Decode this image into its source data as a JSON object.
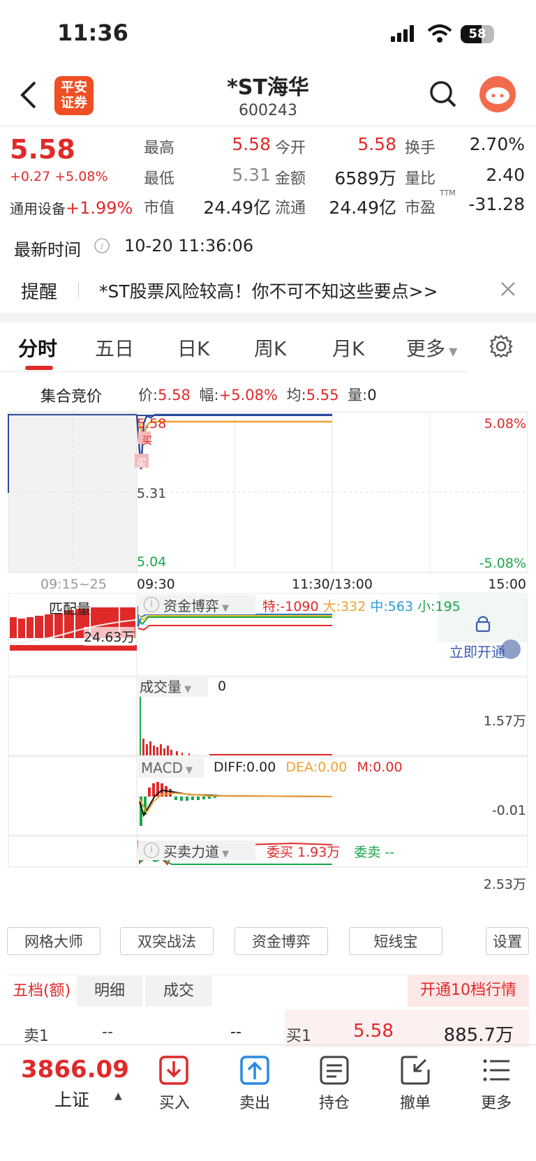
{
  "status": {
    "time": "11:36",
    "battery": "58"
  },
  "header": {
    "logo_line1": "平安",
    "logo_line2": "证券",
    "title": "*ST海华",
    "code": "600243"
  },
  "quote": {
    "price": "5.58",
    "change": "+0.27 +5.08%",
    "industry_label": "通用设备",
    "industry_change": "+1.99%",
    "rows": [
      {
        "l1": "最高",
        "v1": "5.58",
        "l2": "今开",
        "v2": "5.58",
        "l3": "换手",
        "v3": "2.70%"
      },
      {
        "l1": "最低",
        "v1": "5.31",
        "l2": "金额",
        "v2": "6589万",
        "l3": "量比",
        "v3": "2.40"
      },
      {
        "l1": "市值",
        "v1": "24.49亿",
        "l2": "流通",
        "v2": "24.49亿",
        "l3": "市盈",
        "v3": "-31.28"
      }
    ],
    "pe_sup": "TTM",
    "latest_label": "最新时间",
    "latest_time": "10-20 11:36:06"
  },
  "alert": {
    "label": "提醒",
    "text": "*ST股票风险较高！你不可不知这些要点>>"
  },
  "tabs": [
    "分时",
    "五日",
    "日K",
    "周K",
    "月K",
    "更多"
  ],
  "chart": {
    "auction_label": "集合竞价",
    "price_label": "价:",
    "price_value": "5.58",
    "amp_label": "幅:",
    "amp_value": "+5.08%",
    "avg_label": "均:",
    "avg_value": "5.55",
    "vol_label": "量:",
    "vol_value": "0",
    "y_top_left": "5.58",
    "y_mid_left": "5.31",
    "y_bottom_left": "5.04",
    "y_top_right": "5.08%",
    "y_bottom_right": "-5.08%",
    "buy_marker": "买",
    "x_labels": [
      "09:15~25",
      "09:30",
      "11:30/13:00",
      "15:00"
    ],
    "match_label": "匹配量",
    "match_value": "24.63万",
    "capital_label": "资金博弈",
    "cap_te": "特:-1090",
    "cap_da": "大:332",
    "cap_zhong": "中:563",
    "cap_xiao": "小:195",
    "unlock_text": "立即开通",
    "volume_label": "成交量",
    "volume_value": "0",
    "volume_max": "1.57万",
    "macd_label": "MACD",
    "diff": "DIFF:0.00",
    "dea": "DEA:0.00",
    "m": "M:0.00",
    "macd_right": "-0.01",
    "force_label": "买卖力道",
    "wei_buy": "委买 1.93万",
    "wei_sell": "委卖 --",
    "force_max": "2.53万"
  },
  "tools": [
    "网格大师",
    "双突战法",
    "资金博弈",
    "短线宝",
    "设置"
  ],
  "order": {
    "tabs": [
      "五档(额)",
      "明细",
      "成交"
    ],
    "upgrade": "开通10档行情",
    "sell1_label": "卖1",
    "sell1_price": "--",
    "sell1_amt": "--",
    "buy1_label": "买1",
    "buy1_price": "5.58",
    "buy1_amt": "885.7万"
  },
  "bottom": {
    "index_value": "3866.09",
    "index_name": "上证",
    "nav": [
      "买入",
      "卖出",
      "持仓",
      "撤单",
      "更多"
    ]
  },
  "colors": {
    "up": "#e02a2a",
    "down": "#1aa64a",
    "price_line": "#2a4a9a",
    "avg_line": "#f0a030"
  }
}
